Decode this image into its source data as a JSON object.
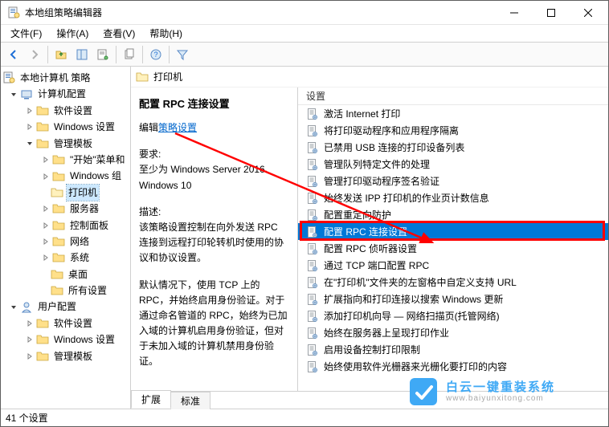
{
  "window": {
    "title": "本地组策略编辑器"
  },
  "menu": {
    "file": "文件(F)",
    "action": "操作(A)",
    "view": "查看(V)",
    "help": "帮助(H)"
  },
  "tree": {
    "root": "本地计算机 策略",
    "computer_config": "计算机配置",
    "software_settings": "软件设置",
    "windows_settings": "Windows 设置",
    "admin_templates": "管理模板",
    "start_menu": "\"开始\"菜单和",
    "windows_components": "Windows 组",
    "printers": "打印机",
    "servers": "服务器",
    "control_panel": "控制面板",
    "network": "网络",
    "system": "系统",
    "desktop": "桌面",
    "all_settings": "所有设置",
    "user_config": "用户配置",
    "u_software_settings": "软件设置",
    "u_windows_settings": "Windows 设置",
    "u_admin_templates": "管理模板"
  },
  "header": {
    "title": "打印机"
  },
  "detail": {
    "title": "配置 RPC 连接设置",
    "edit_prefix": "编辑",
    "edit_link": "策略设置",
    "require_label": "要求:",
    "require_text": "至少为 Windows Server 2016、Windows 10",
    "desc_label": "描述:",
    "desc_p1": "该策略设置控制在向外发送 RPC 连接到远程打印轮转机时使用的协议和协议设置。",
    "desc_p2": "默认情况下，使用 TCP 上的 RPC，并始终启用身份验证。对于通过命名管道的 RPC，始终为已加入域的计算机启用身份验证，但对于未加入域的计算机禁用身份验证。"
  },
  "list": {
    "header": "设置",
    "items": [
      "激活 Internet 打印",
      "将打印驱动程序和应用程序隔离",
      "已禁用 USB 连接的打印设备列表",
      "管理队列特定文件的处理",
      "管理打印驱动程序签名验证",
      "始终发送 IPP 打印机的作业页计数信息",
      "配置重定向防护",
      "配置 RPC 连接设置",
      "配置 RPC 侦听器设置",
      "通过 TCP 端口配置 RPC",
      "在\"打印机\"文件夹的左窗格中自定义支持 URL",
      "扩展指向和打印连接以搜索 Windows 更新",
      "添加打印机向导 — 网络扫描页(托管网络)",
      "始终在服务器上呈现打印作业",
      "启用设备控制打印限制",
      "始终使用软件光栅器来光栅化要打印的内容"
    ],
    "selected_index": 7
  },
  "tabs": {
    "extended": "扩展",
    "standard": "标准"
  },
  "status": {
    "text": "41 个设置"
  },
  "watermark": {
    "line1": "白云一键重装系统",
    "line2": "www.baiyunxitong.com"
  }
}
